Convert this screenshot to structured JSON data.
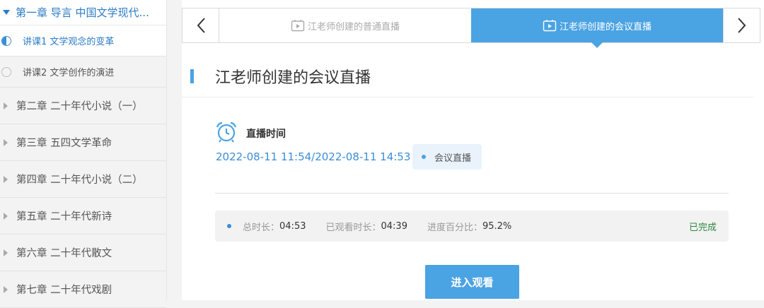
{
  "sidebar": {
    "active_chapter": "第一章 导言 中国文学现代...",
    "lessons": [
      {
        "label": "讲课1 文学观念的变革",
        "state": "in-progress"
      },
      {
        "label": "讲课2 文学创作的演进",
        "state": "not-started"
      }
    ],
    "chapters": [
      "第二章 二十年代小说（一）",
      "第三章 五四文学革命",
      "第四章 二十年代小说（二）",
      "第五章 二十年代新诗",
      "第六章 二十年代散文",
      "第七章 二十年代戏剧"
    ]
  },
  "tabs": [
    {
      "label": "江老师创建的普通直播",
      "active": false
    },
    {
      "label": "江老师创建的会议直播",
      "active": true
    }
  ],
  "page_title": "江老师创建的会议直播",
  "live_time": {
    "label": "直播时间",
    "value": "2022-08-11 11:54/2022-08-11 14:53"
  },
  "type_badge": "会议直播",
  "progress": {
    "total_label": "总时长：",
    "total_value": "04:53",
    "watched_label": "已观看时长：",
    "watched_value": "04:39",
    "percent_label": "进度百分比：",
    "percent_value": "95.2%",
    "status": "已完成"
  },
  "watch_button": "进入观看",
  "colors": {
    "accent": "#4aa3e3",
    "link_blue": "#3a8ed6",
    "done_green": "#2a8a3a"
  }
}
